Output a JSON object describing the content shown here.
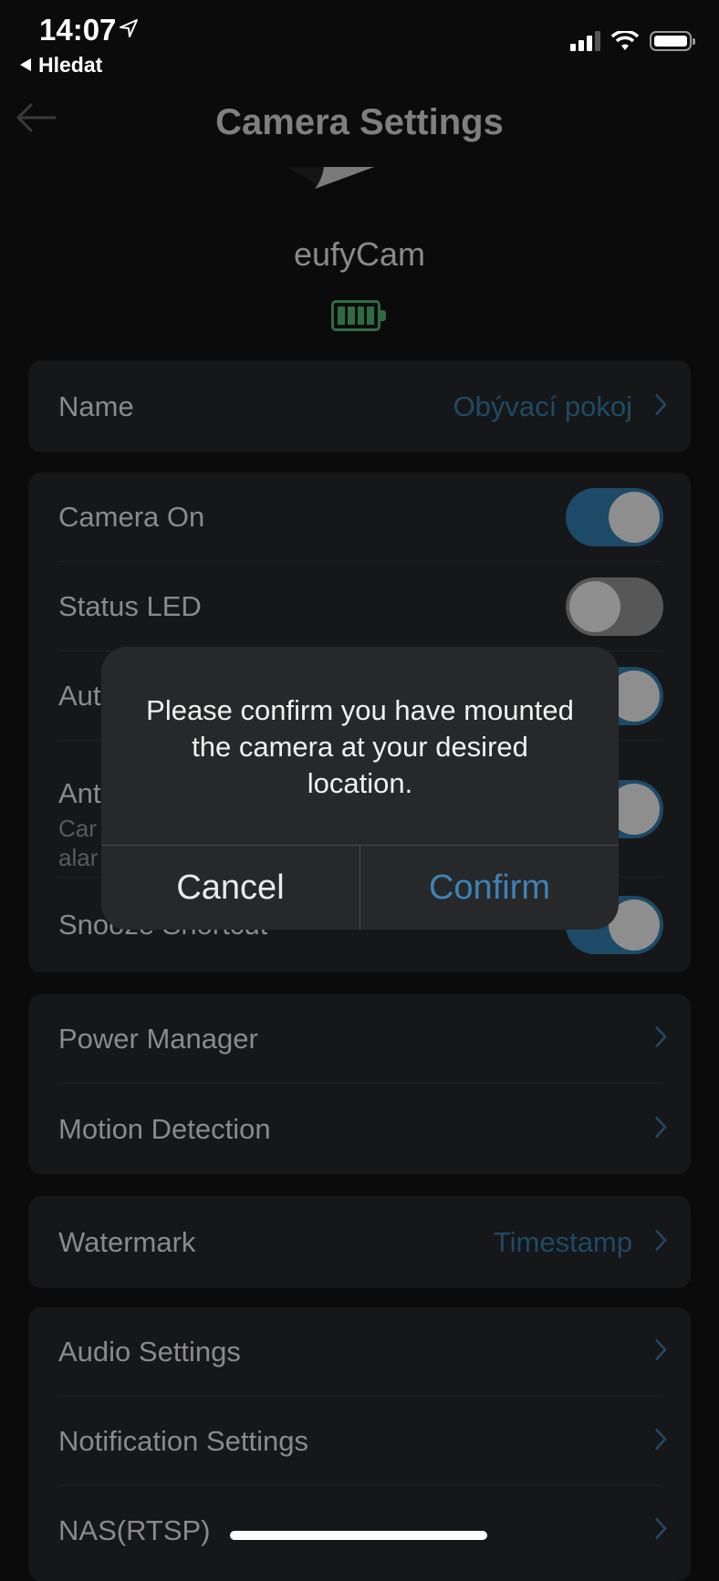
{
  "status_bar": {
    "time": "14:07",
    "back_app": "Hledat",
    "icons": [
      "location-arrow-icon",
      "cellular-signal-icon",
      "wifi-icon",
      "battery-icon"
    ]
  },
  "nav": {
    "title": "Camera Settings",
    "back_icon": "arrow-left-icon"
  },
  "device": {
    "name": "eufyCam",
    "battery_level_bars": 4,
    "battery_color": "#2f6b42"
  },
  "sections": {
    "name_card": {
      "label": "Name",
      "value": "Obývací pokoj"
    },
    "toggles": [
      {
        "label": "Camera On",
        "state": "on"
      },
      {
        "label": "Status LED",
        "state": "off"
      },
      {
        "label": "Aut",
        "state": "on"
      },
      {
        "label": "Ant",
        "sub": "Car\nalar",
        "state": "on"
      },
      {
        "label": "Snooze Shortcut",
        "state": "on"
      }
    ],
    "power_card": [
      {
        "label": "Power Manager"
      },
      {
        "label": "Motion Detection"
      }
    ],
    "watermark_card": {
      "label": "Watermark",
      "value": "Timestamp"
    },
    "settings_card": [
      {
        "label": "Audio Settings"
      },
      {
        "label": "Notification Settings"
      },
      {
        "label": "NAS(RTSP)"
      }
    ]
  },
  "dialog": {
    "message": "Please confirm you have mounted the camera at your desired location.",
    "cancel_label": "Cancel",
    "confirm_label": "Confirm"
  },
  "colors": {
    "accent": "#3d82b7",
    "toggle_on": "#1d4a66",
    "background": "#0b0b0c",
    "card": "#161719"
  }
}
